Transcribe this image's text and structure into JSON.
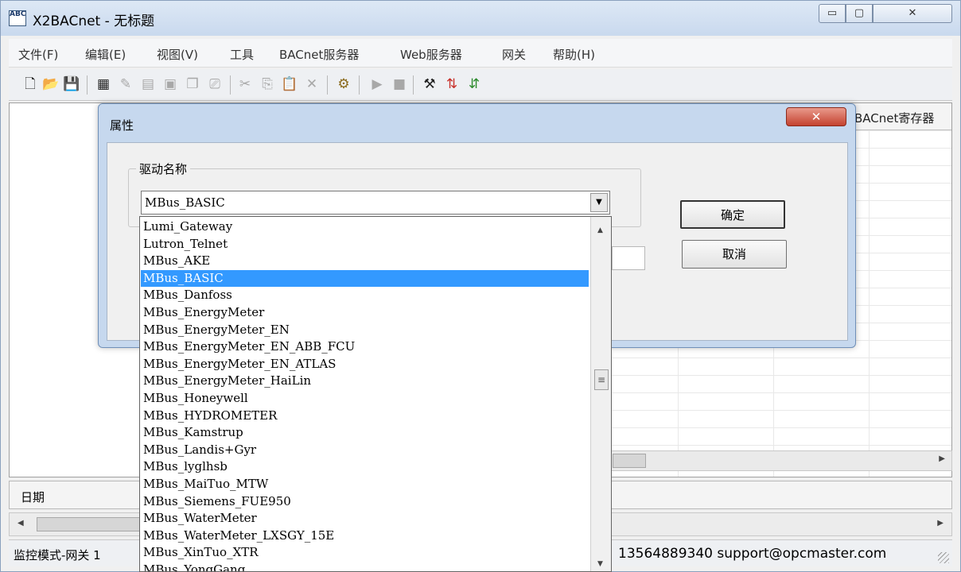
{
  "window": {
    "title": "X2BACnet - 无标题",
    "app_icon": "ABC",
    "controls": {
      "minimize": "▭",
      "maximize": "▢",
      "close": "✕"
    }
  },
  "menu": [
    "文件(F)",
    "编辑(E)",
    "视图(V)",
    "工具",
    "BACnet服务器",
    "Web服务器",
    "网关",
    "帮助(H)"
  ],
  "toolbar": {
    "icons": [
      "new-file-icon",
      "open-folder-icon",
      "save-icon",
      "table-icon",
      "tag-icon",
      "grid-icon",
      "document-icon",
      "copy-page-icon",
      "properties-icon",
      "cut-icon",
      "copy-icon",
      "paste-icon",
      "delete-icon",
      "run-config-icon",
      "play-icon",
      "stop-icon",
      "tools-icon",
      "load-icon",
      "arrows-icon"
    ],
    "glyphs": [
      "🗋",
      "📂",
      "💾",
      "▦",
      "✎",
      "▤",
      "▣",
      "❐",
      "⎚",
      "✂",
      "⎘",
      "📋",
      "✕",
      "⚙",
      "▶",
      "■",
      "⚒",
      "⇅",
      "⇵"
    ]
  },
  "grid": {
    "last_column_header": "BACnet寄存器"
  },
  "log": {
    "date_column": "日期"
  },
  "status": {
    "left": "监控模式-网关 1",
    "right": "13564889340 support@opcmaster.com"
  },
  "dialog": {
    "title": "属性",
    "close_label": "✕",
    "group_label": "驱动名称",
    "driver_value": "MBus_BASIC",
    "ok_label": "确定",
    "cancel_label": "取消",
    "dropdown_arrow": "▼"
  },
  "dropdown": {
    "selected_index": 3,
    "options": [
      "Lumi_Gateway",
      "Lutron_Telnet",
      "MBus_AKE",
      "MBus_BASIC",
      "MBus_Danfoss",
      "MBus_EnergyMeter",
      "MBus_EnergyMeter_EN",
      "MBus_EnergyMeter_EN_ABB_FCU",
      "MBus_EnergyMeter_EN_ATLAS",
      "MBus_EnergyMeter_HaiLin",
      "MBus_Honeywell",
      "MBus_HYDROMETER",
      "MBus_Kamstrup",
      "MBus_Landis+Gyr",
      "MBus_lyglhsb",
      "MBus_MaiTuo_MTW",
      "MBus_Siemens_FUE950",
      "MBus_WaterMeter",
      "MBus_WaterMeter_LXSGY_15E",
      "MBus_XinTuo_XTR",
      "MBus_YongGang"
    ],
    "scroll_up": "▲",
    "scroll_down": "▼",
    "scroll_grip": "≡"
  },
  "colors": {
    "selection": "#3399ff",
    "dialog_frame": "#c6d8ee",
    "close_red": "#c4422f"
  }
}
